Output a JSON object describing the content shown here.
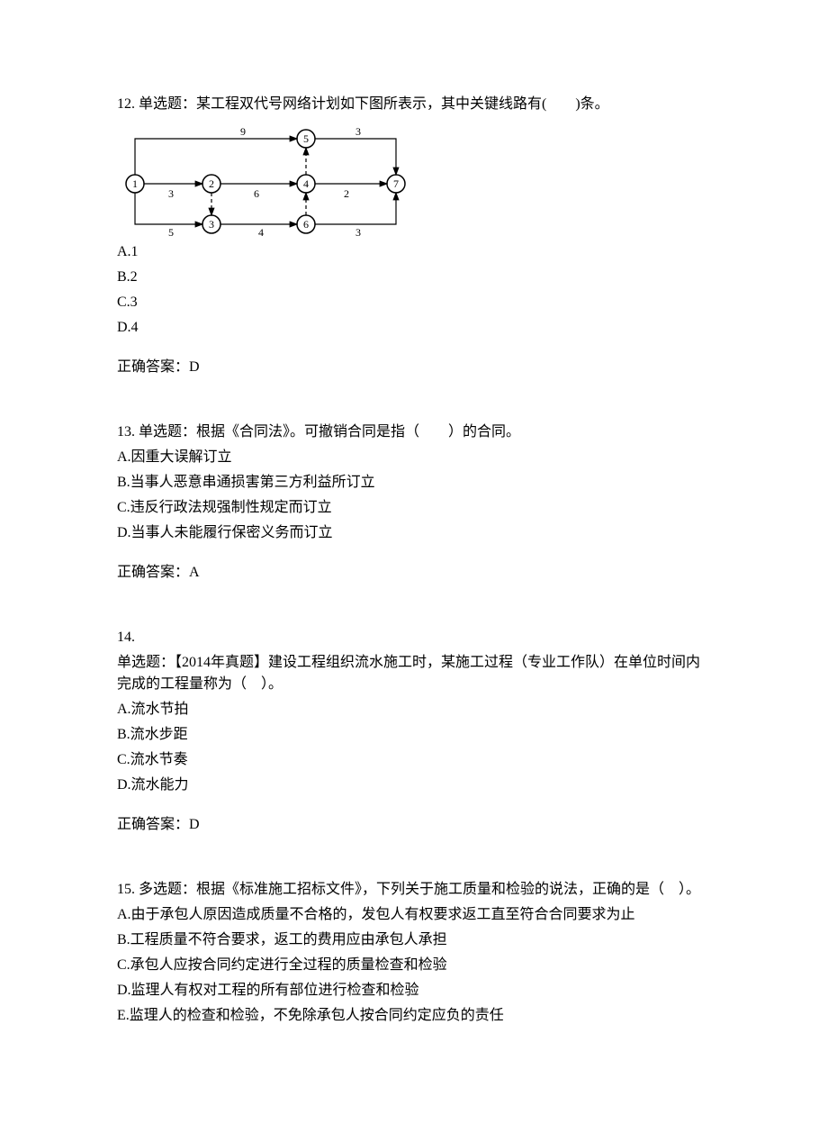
{
  "q12": {
    "stem": "12. 单选题：某工程双代号网络计划如下图所表示，其中关键线路有(　　)条。",
    "optA": "A.1",
    "optB": "B.2",
    "optC": "C.3",
    "optD": "D.4",
    "ansLabel": "正确答案：D",
    "diagram": {
      "nodes": [
        "1",
        "2",
        "3",
        "4",
        "5",
        "6",
        "7"
      ],
      "edge_1_5": "9",
      "edge_5_7": "3",
      "edge_1_2": "3",
      "edge_2_4": "6",
      "edge_4_7": "2",
      "edge_2_3": "5",
      "edge_3_6": "4",
      "edge_6_7": "3"
    }
  },
  "q13": {
    "stem": "13. 单选题：根据《合同法》。可撤销合同是指（　　）的合同。",
    "optA": "A.因重大误解订立",
    "optB": "B.当事人恶意串通损害第三方利益所订立",
    "optC": "C.违反行政法规强制性规定而订立",
    "optD": "D.当事人未能履行保密义务而订立",
    "ansLabel": "正确答案：A"
  },
  "q14": {
    "num": "14.",
    "stem": "单选题：【2014年真题】建设工程组织流水施工时，某施工过程（专业工作队）在单位时间内完成的工程量称为（　）。",
    "optA": "A.流水节拍",
    "optB": "B.流水步距",
    "optC": "C.流水节奏",
    "optD": "D.流水能力",
    "ansLabel": "正确答案：D"
  },
  "q15": {
    "stem": "15. 多选题：根据《标准施工招标文件》，下列关于施工质量和检验的说法，正确的是（　）。",
    "optA": "A.由于承包人原因造成质量不合格的，发包人有权要求返工直至符合合同要求为止",
    "optB": "B.工程质量不符合要求，返工的费用应由承包人承担",
    "optC": "C.承包人应按合同约定进行全过程的质量检查和检验",
    "optD": "D.监理人有权对工程的所有部位进行检查和检验",
    "optE": "E.监理人的检查和检验，不免除承包人按合同约定应负的责任"
  }
}
